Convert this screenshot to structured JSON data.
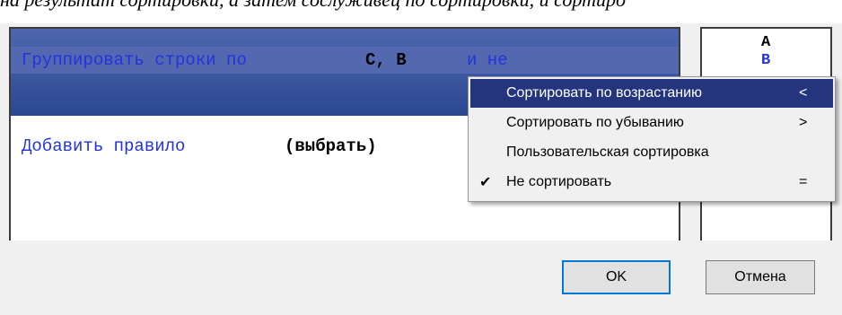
{
  "background_text": "на результат сортировки, а затем сослуживец по сортировки, и сортиро",
  "rules": {
    "group_prefix": "Группировать строки по",
    "group_keys": "C, B",
    "group_suffix": "и не",
    "add_rule_label": "Добавить правило",
    "add_rule_value": "(выбрать)"
  },
  "preview": {
    "row1": "A",
    "row2": "B"
  },
  "context_menu": {
    "items": [
      {
        "label": "Сортировать по возрастанию",
        "shortcut": "<",
        "checked": false,
        "selected": true
      },
      {
        "label": "Сортировать по убыванию",
        "shortcut": ">",
        "checked": false,
        "selected": false
      },
      {
        "label": "Пользовательская сортировка",
        "shortcut": "",
        "checked": false,
        "selected": false
      },
      {
        "label": "Не сортировать",
        "shortcut": "=",
        "checked": true,
        "selected": false
      }
    ],
    "check_glyph": "✔"
  },
  "buttons": {
    "ok": "OK",
    "cancel": "Отмена"
  },
  "colors": {
    "header_blue": "#3f5aa3",
    "link_blue": "#2233dd",
    "menu_highlight": "#24357e"
  }
}
